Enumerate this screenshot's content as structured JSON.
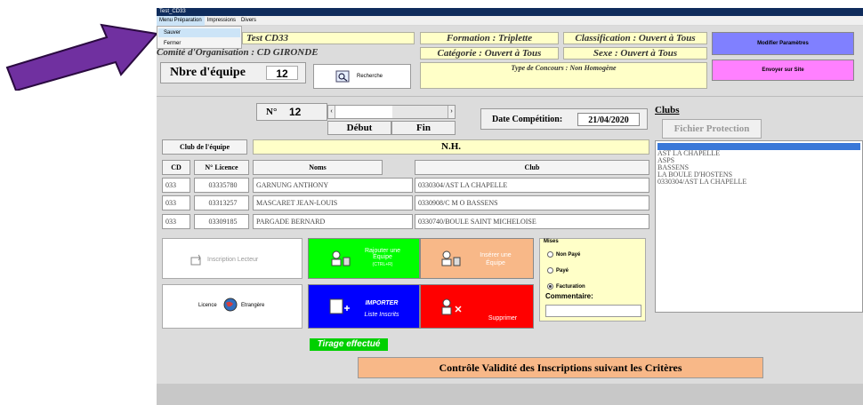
{
  "window": {
    "title": "Test_CD33"
  },
  "menu": {
    "items": [
      "Menu Préparation",
      "Impressions",
      "Divers"
    ]
  },
  "dropdown": {
    "items": [
      "Sauver",
      "Fermer"
    ]
  },
  "header": {
    "event_name": "Test  CD33",
    "organisation": "Comité d'Organisation : CD GIRONDE",
    "team_count_label": "Nbre d'équipe",
    "team_count": "12",
    "search_label": "Recherche",
    "formation": "Formation : Triplette",
    "classification": "Classification : Ouvert à Tous",
    "categorie": "Catégorie : Ouvert à Tous",
    "sexe": "Sexe : Ouvert à Tous",
    "type_concours": "Type de Concours : Non Homogène",
    "modify_button": "Modifier Paramètres",
    "send_button": "Envoyer sur Site"
  },
  "team": {
    "number_label": "N°",
    "number": "12",
    "debut_label": "Début",
    "fin_label": "Fin",
    "date_label": "Date Compétition:",
    "date": "21/04/2020",
    "club_label": "Club de l'équipe",
    "club_value": "N.H.",
    "columns": [
      "CD",
      "N° Licence",
      "Noms",
      "Club"
    ],
    "rows": [
      {
        "cd": "033",
        "licence": "03335780",
        "nom": "GARNUNG ANTHONY",
        "club": "0330304/AST LA CHAPELLE"
      },
      {
        "cd": "033",
        "licence": "03313257",
        "nom": "MASCARET JEAN-LOUIS",
        "club": "0330908/C M O BASSENS"
      },
      {
        "cd": "033",
        "licence": "03309185",
        "nom": "PARGADE BERNARD",
        "club": "0330740/BOULE SAINT MICHELOISE"
      }
    ]
  },
  "clubs": {
    "title": "Clubs",
    "protection_button": "Fichier Protection",
    "items": [
      "ASPS",
      "AST LA CHAPELLE",
      "ASPS",
      "BASSENS",
      "LA BOULE D'HOSTENS",
      "0330304/AST LA CHAPELLE"
    ],
    "selected_index": 0
  },
  "actions": {
    "reader": "Inscription Lecteur",
    "add_team": "Rajouter une Équipe",
    "add_team_shortcut": "(CTRL+R)",
    "insert_team": "Insérer une Équipe",
    "licence": "Licence",
    "foreign": "Etrangère",
    "import_title": "IMPORTER",
    "import_sub": "Liste Inscrits",
    "delete": "Supprimer"
  },
  "mises": {
    "title": "Mises",
    "options": [
      "Non Payé",
      "Payé",
      "Facturation"
    ],
    "selected": "Facturation",
    "comment_label": "Commentaire:",
    "comment_value": ""
  },
  "footer": {
    "draw_status": "Tirage effectué",
    "validate_button": "Contrôle Validité des Inscriptions suivant les Critères"
  },
  "colors": {
    "arrow": "#7030a0",
    "title_bg": "#0f2c5c",
    "modify_btn": "#8080ff",
    "send_btn": "#ff80ff",
    "add_btn": "#00ff00",
    "insert_btn": "#f8b888",
    "import_btn": "#0000ff",
    "delete_btn": "#ff0000",
    "validate_btn": "#f8b888",
    "draw_status_bg": "#00d000"
  }
}
